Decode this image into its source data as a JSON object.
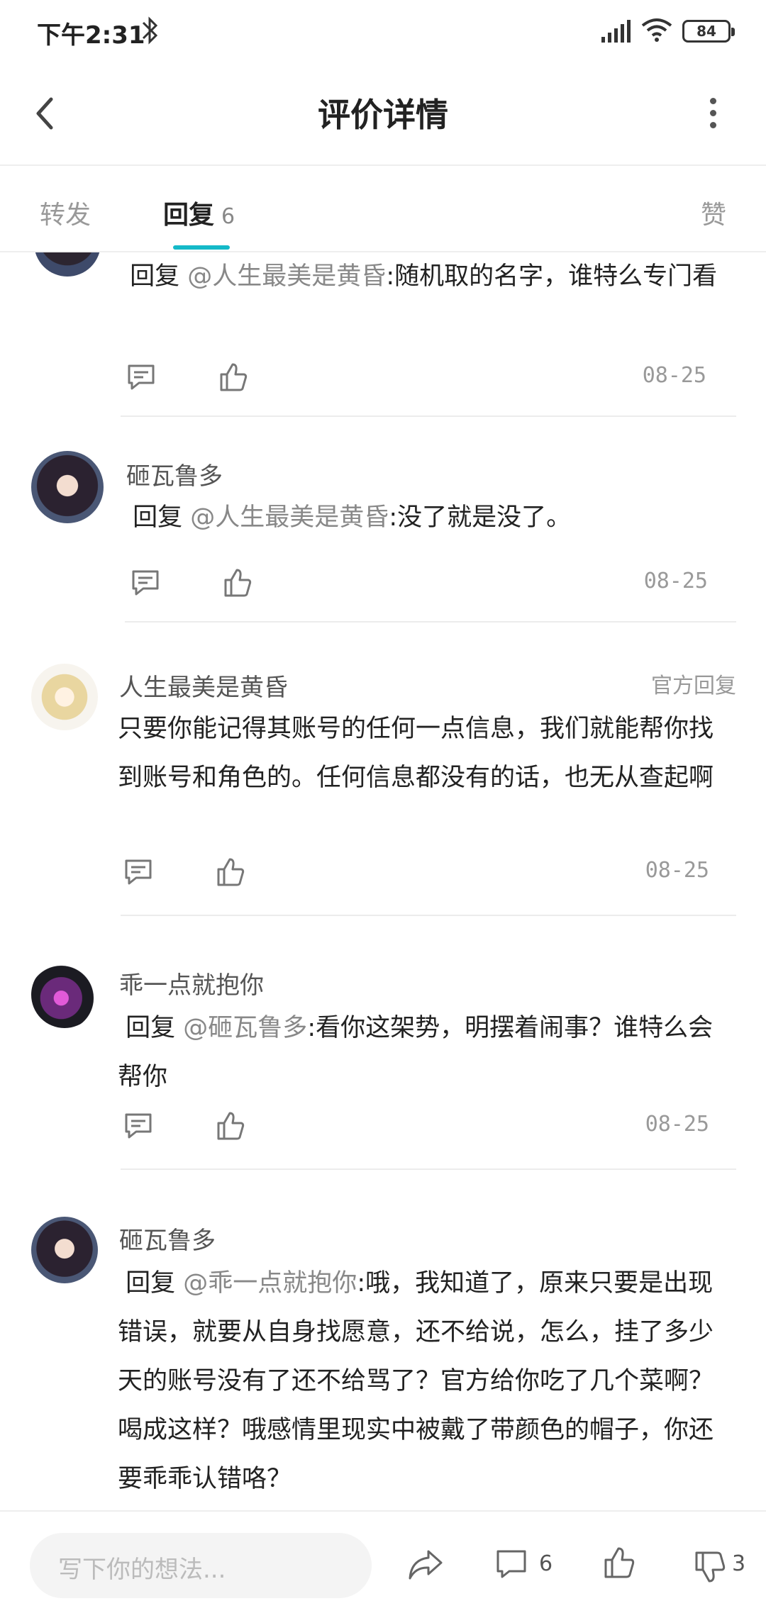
{
  "status_bar": {
    "time": "下午2:31",
    "battery": "84"
  },
  "header": {
    "title": "评价详情"
  },
  "tabs": {
    "forward": "转发",
    "reply": "回复",
    "reply_count": "6",
    "like": "赞"
  },
  "comments": [
    {
      "prefix": "回复",
      "mention": "@人生最美是黄昏",
      "text": ":随机取的名字，谁特么专门看",
      "date": "08-25"
    },
    {
      "name": "砸瓦鲁多",
      "prefix": "回复",
      "mention": "@人生最美是黄昏",
      "text": ":没了就是没了。",
      "date": "08-25"
    },
    {
      "name": "人生最美是黄昏",
      "badge": "官方回复",
      "text": "只要你能记得其账号的任何一点信息，我们就能帮你找到账号和角色的。任何信息都没有的话，也无从查起啊",
      "date": "08-25"
    },
    {
      "name": "乖一点就抱你",
      "prefix": "回复",
      "mention": "@砸瓦鲁多",
      "text": ":看你这架势，明摆着闹事？谁特么会帮你",
      "date": "08-25"
    },
    {
      "name": "砸瓦鲁多",
      "prefix": "回复",
      "mention": "@乖一点就抱你",
      "text": ":哦，我知道了，原来只要是出现错误，就要从自身找愿意，还不给说，怎么，挂了多少天的账号没有了还不给骂了？官方给你吃了几个菜啊？喝成这样？哦感情里现实中被戴了带颜色的帽子，你还要乖乖认错咯？"
    }
  ],
  "bottom_bar": {
    "placeholder": "写下你的想法...",
    "comment_count": "6",
    "dislike_count": "3"
  }
}
